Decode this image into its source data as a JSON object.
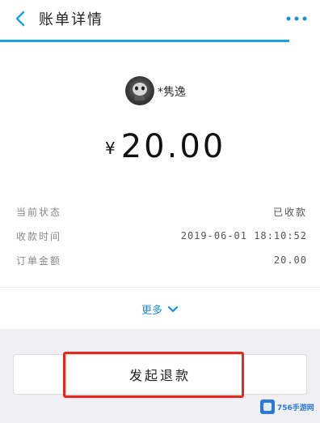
{
  "header": {
    "title": "账单详情",
    "back_icon": "chevron-left-icon",
    "menu_icon": "more-dots-icon",
    "accent": "#1aa1e6"
  },
  "payer": {
    "name": "*隽逸",
    "avatar_icon": "avatar"
  },
  "amount": {
    "symbol": "¥",
    "value": "20.00"
  },
  "details": [
    {
      "label": "当前状态",
      "value": "已收款"
    },
    {
      "label": "收款时间",
      "value": "2019-06-01 18:10:52"
    },
    {
      "label": "订单金额",
      "value": "20.00"
    }
  ],
  "more": {
    "label": "更多",
    "icon": "chevron-down-icon",
    "color": "#1a8fe0"
  },
  "actions": {
    "refund_label": "发起退款",
    "highlight_color": "#e8261f"
  },
  "watermark": {
    "text": "756手游网"
  }
}
